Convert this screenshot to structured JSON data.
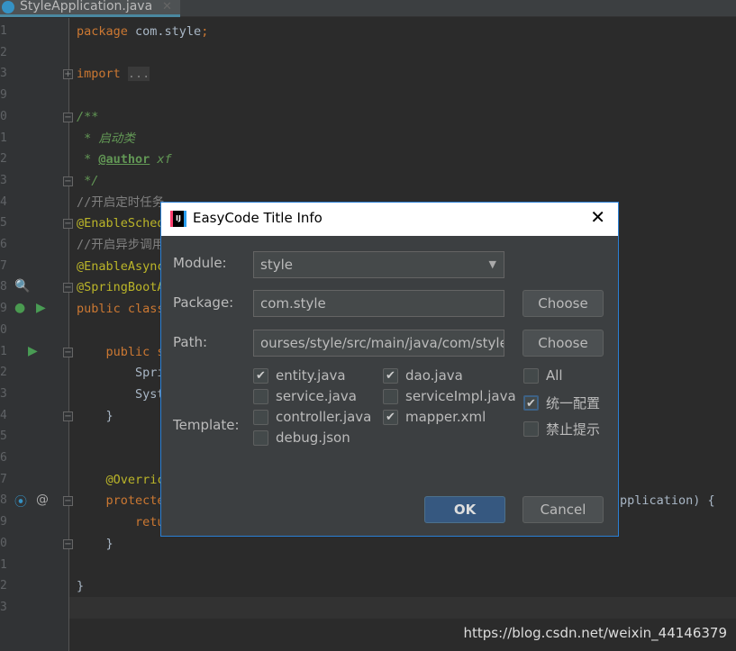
{
  "tab": {
    "title": "StyleApplication.java"
  },
  "editor": {
    "lines": [
      {
        "n": "1",
        "segs": [
          [
            "kw",
            "package "
          ],
          [
            "pl",
            "com.style"
          ],
          [
            "kw",
            ";"
          ]
        ]
      },
      {
        "n": "2",
        "segs": []
      },
      {
        "n": "3",
        "fold": "+",
        "segs": [
          [
            "kw",
            "import "
          ],
          [
            "fd",
            "..."
          ]
        ]
      },
      {
        "n": "9",
        "segs": []
      },
      {
        "n": "0",
        "fold": "-",
        "segs": [
          [
            "doc",
            "/**"
          ]
        ]
      },
      {
        "n": "1",
        "segs": [
          [
            "doc",
            " * 启动类"
          ]
        ]
      },
      {
        "n": "2",
        "segs": [
          [
            "doc",
            " * "
          ],
          [
            "tag",
            "@author"
          ],
          [
            "doc",
            " xf"
          ]
        ]
      },
      {
        "n": "3",
        "fold": "-",
        "segs": [
          [
            "doc",
            " */"
          ]
        ]
      },
      {
        "n": "4",
        "segs": [
          [
            "cm",
            "//开启定时任务"
          ]
        ]
      },
      {
        "n": "5",
        "fold": "-",
        "segs": [
          [
            "an",
            "@EnableSched"
          ]
        ]
      },
      {
        "n": "6",
        "segs": [
          [
            "cm",
            "//开启异步调用"
          ]
        ]
      },
      {
        "n": "7",
        "segs": [
          [
            "an",
            "@EnableAsync"
          ]
        ]
      },
      {
        "n": "8",
        "fold": "-",
        "icon": "spring-bean",
        "segs": [
          [
            "an",
            "@SpringBootA"
          ]
        ]
      },
      {
        "n": "9",
        "icon": "spring-run",
        "segs": [
          [
            "kw",
            "public class"
          ]
        ]
      },
      {
        "n": "0",
        "segs": []
      },
      {
        "n": "1",
        "fold": "-",
        "icon": "run",
        "segs": [
          [
            "kw",
            "    public s"
          ]
        ]
      },
      {
        "n": "2",
        "segs": [
          [
            "pl",
            "        Spri"
          ]
        ]
      },
      {
        "n": "3",
        "segs": [
          [
            "pl",
            "        Syst"
          ]
        ]
      },
      {
        "n": "4",
        "fold": "-",
        "segs": [
          [
            "pl",
            "    }"
          ]
        ]
      },
      {
        "n": "5",
        "segs": []
      },
      {
        "n": "6",
        "segs": []
      },
      {
        "n": "7",
        "segs": [
          [
            "an",
            "    @Overric"
          ]
        ]
      },
      {
        "n": "8",
        "fold": "-",
        "icon": "override",
        "segs": [
          [
            "kw",
            "    protecte"
          ]
        ],
        "tail": "pplication) {"
      },
      {
        "n": "9",
        "segs": [
          [
            "kw",
            "        retu"
          ]
        ]
      },
      {
        "n": "0",
        "fold": "-",
        "segs": [
          [
            "pl",
            "    }"
          ]
        ]
      },
      {
        "n": "1",
        "segs": []
      },
      {
        "n": "2",
        "segs": [
          [
            "pl",
            "}"
          ]
        ]
      },
      {
        "n": "3",
        "segs": []
      }
    ]
  },
  "dialog": {
    "title": "EasyCode Title Info",
    "module_label": "Module:",
    "module_value": "style",
    "package_label": "Package:",
    "package_value": "com.style",
    "path_label": "Path:",
    "path_value": "ourses/style/src/main/java/com/style",
    "choose": "Choose",
    "template_label": "Template:",
    "templates": [
      {
        "label": "entity.java",
        "checked": true
      },
      {
        "label": "dao.java",
        "checked": true
      },
      {
        "label": "service.java",
        "checked": false
      },
      {
        "label": "serviceImpl.java",
        "checked": false
      },
      {
        "label": "controller.java",
        "checked": false
      },
      {
        "label": "mapper.xml",
        "checked": true
      },
      {
        "label": "debug.json",
        "checked": false
      }
    ],
    "options": [
      {
        "label": "All",
        "checked": false
      },
      {
        "label": "统一配置",
        "checked": true
      },
      {
        "label": "禁止提示",
        "checked": false
      }
    ],
    "ok": "OK",
    "cancel": "Cancel"
  },
  "watermark": "https://blog.csdn.net/weixin_44146379",
  "colors": {
    "accent": "#2a7fd4",
    "ok_button": "#365880"
  }
}
